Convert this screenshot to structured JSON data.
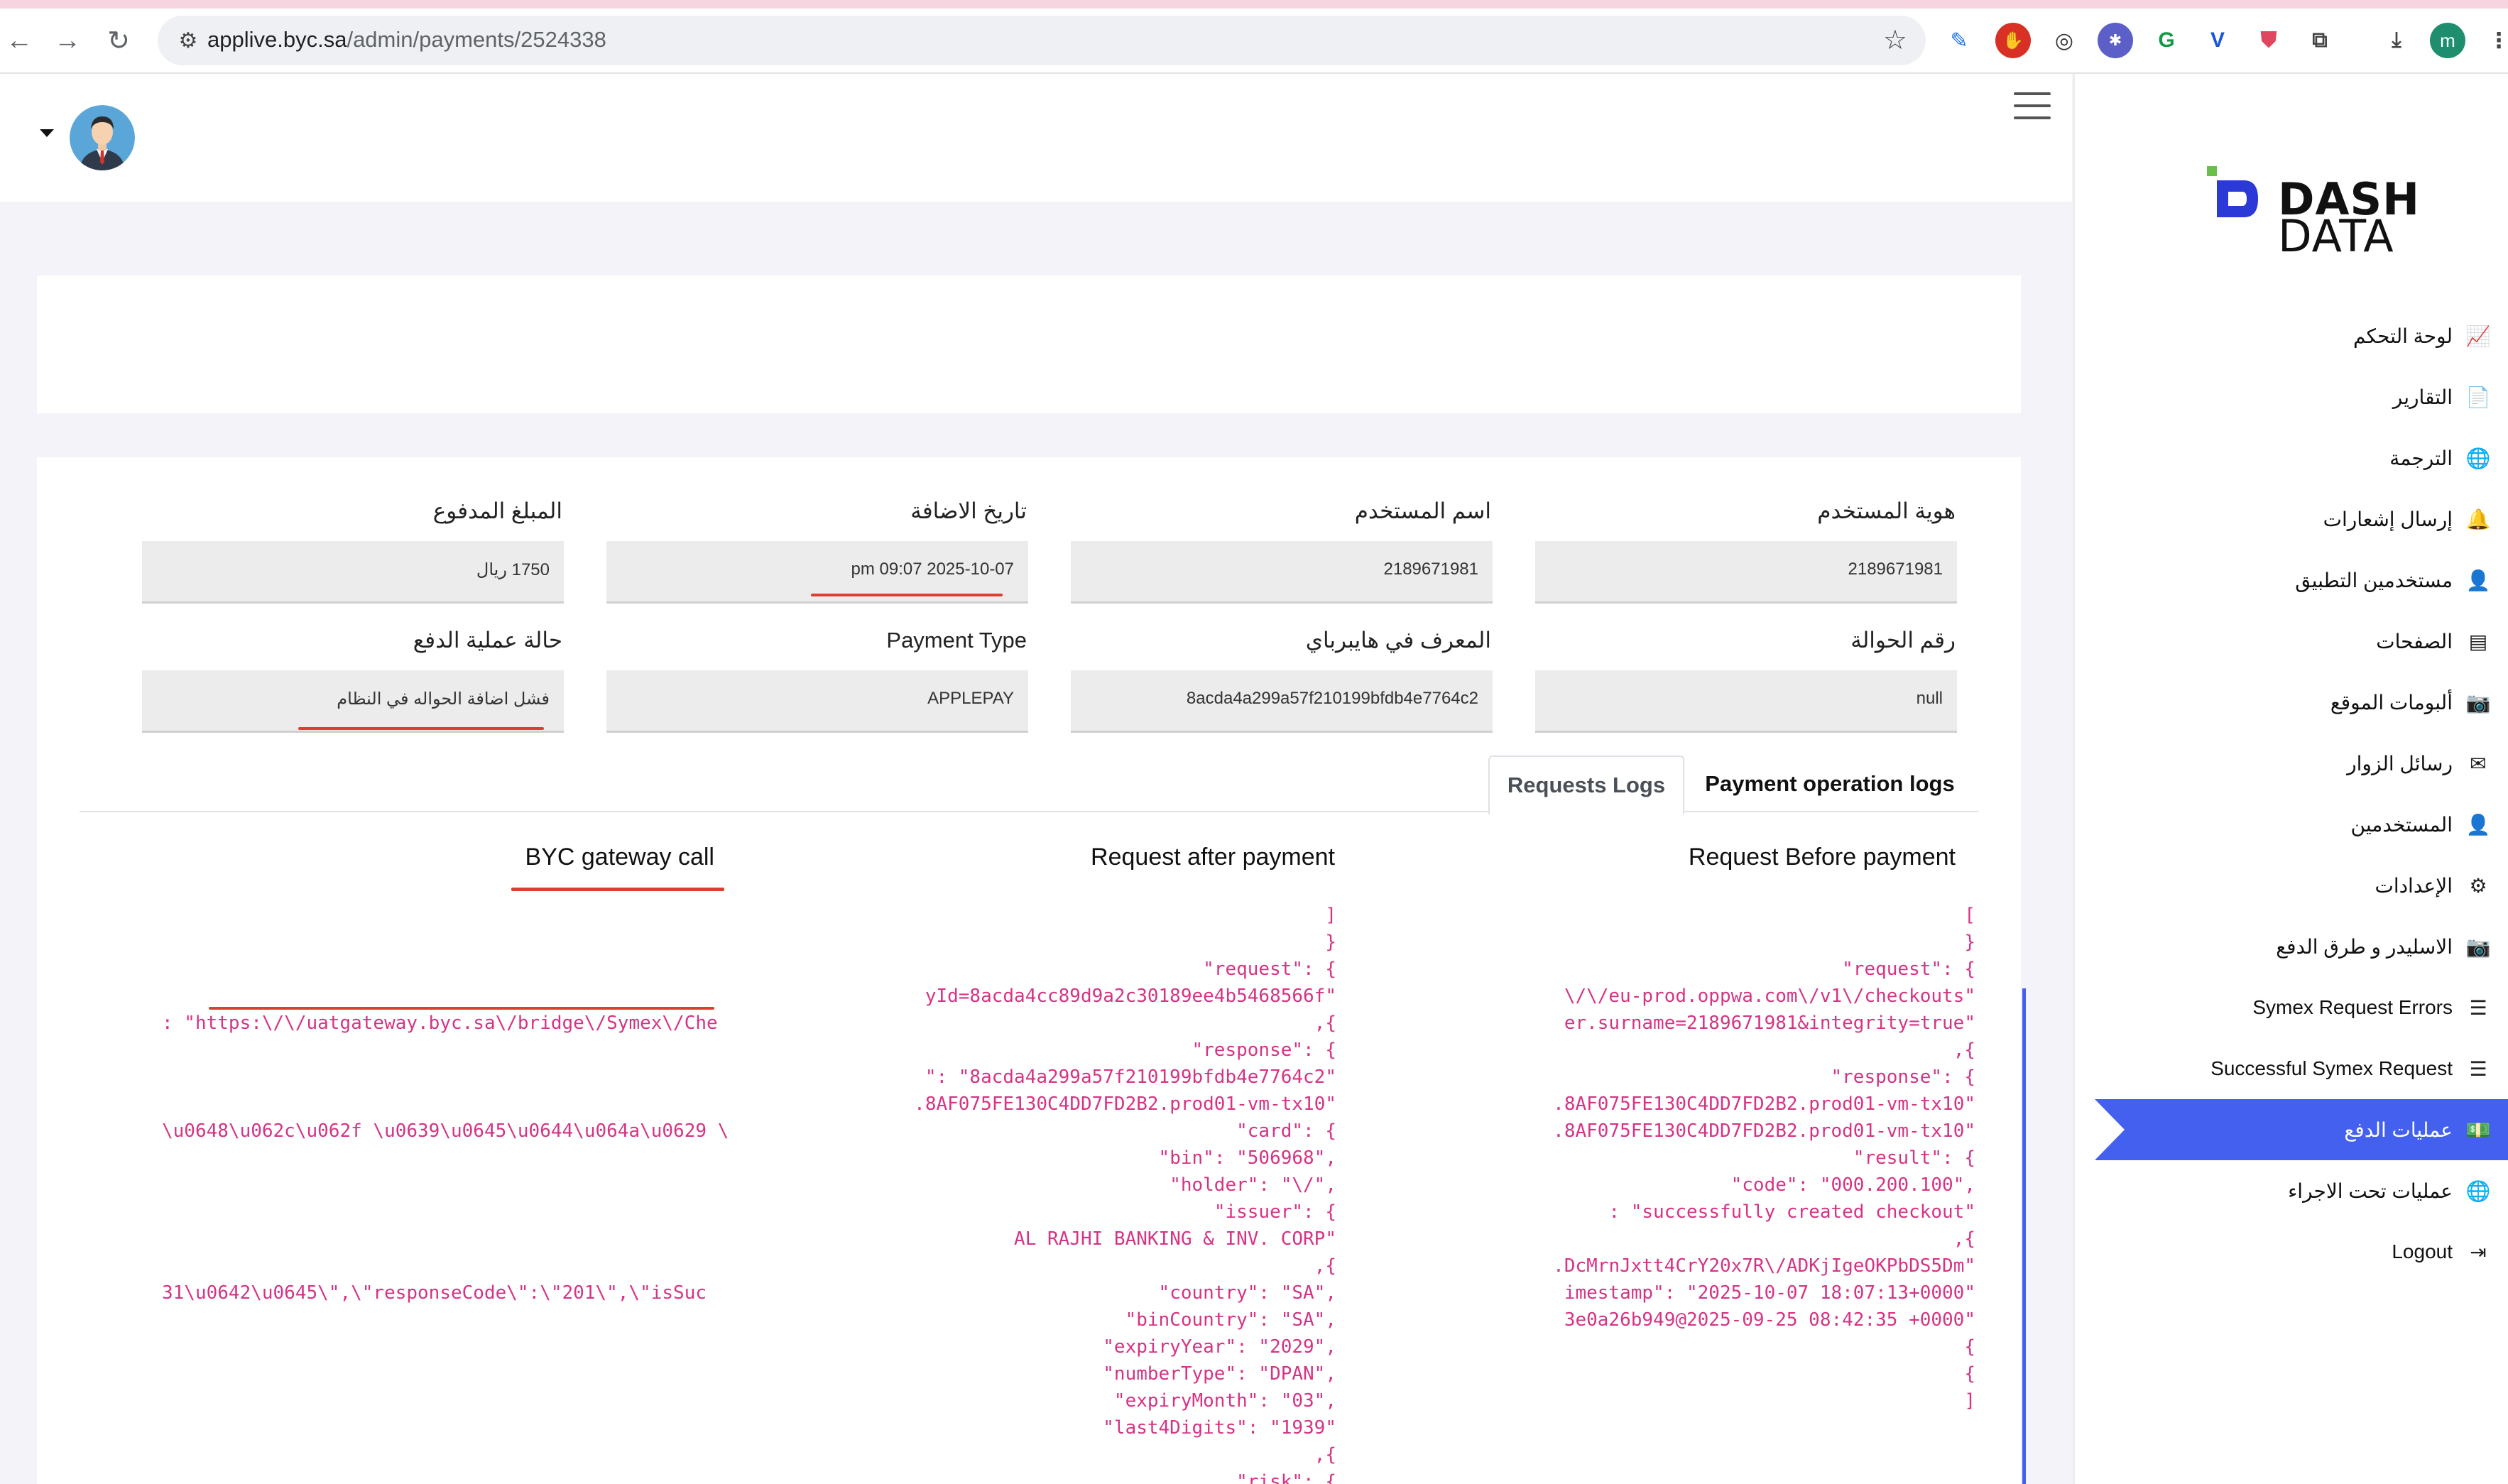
{
  "browser": {
    "url_host": "applive.byc.sa",
    "url_path": "/admin/payments/2524338",
    "profile_initial": "m"
  },
  "sidebar": {
    "logo_line1": "DASH",
    "logo_line2": "DATA",
    "items": [
      {
        "label": "لوحة التحكم",
        "icon": "chart-icon",
        "glyph": "📈"
      },
      {
        "label": "التقارير",
        "icon": "report-icon",
        "glyph": "📄"
      },
      {
        "label": "الترجمة",
        "icon": "globe-icon",
        "glyph": "🌐"
      },
      {
        "label": "إرسال إشعارات",
        "icon": "bell-icon",
        "glyph": "🔔"
      },
      {
        "label": "مستخدمين التطبيق",
        "icon": "user-icon",
        "glyph": "👤"
      },
      {
        "label": "الصفحات",
        "icon": "page-icon",
        "glyph": "▤"
      },
      {
        "label": "ألبومات الموقع",
        "icon": "camera-icon",
        "glyph": "📷"
      },
      {
        "label": "رسائل الزوار",
        "icon": "envelope-icon",
        "glyph": "✉"
      },
      {
        "label": "المستخدمين",
        "icon": "user-icon",
        "glyph": "👤"
      },
      {
        "label": "الإعدادات",
        "icon": "gears-icon",
        "glyph": "⚙"
      },
      {
        "label": "الاسليدر و طرق الدفع",
        "icon": "camera-icon",
        "glyph": "📷"
      },
      {
        "label": "Symex Request Errors",
        "icon": "list-icon",
        "glyph": "☰"
      },
      {
        "label": "Successful Symex Request",
        "icon": "list-icon",
        "glyph": "☰"
      },
      {
        "label": "عمليات الدفع",
        "icon": "money-icon",
        "glyph": "💵"
      },
      {
        "label": "عمليات تحت الاجراء",
        "icon": "globe-icon",
        "glyph": "🌐"
      },
      {
        "label": "Logout",
        "icon": "logout-icon",
        "glyph": "⇥"
      }
    ],
    "active_index": 13
  },
  "fields": {
    "user_id": {
      "label": "هوية المستخدم",
      "value": "2189671981"
    },
    "username": {
      "label": "اسم المستخدم",
      "value": "2189671981"
    },
    "date_added": {
      "label": "تاريخ الاضافة",
      "value": "2025-10-07 09:07 pm"
    },
    "amount_paid": {
      "label": "المبلغ المدفوع",
      "value": "1750 ريال"
    },
    "transfer_no": {
      "label": "رقم الحوالة",
      "value": "null"
    },
    "hyperpay_id": {
      "label": "المعرف في هايبرباي",
      "value": "8acda4a299a57f210199bfdb4e7764c2"
    },
    "payment_type": {
      "label": "Payment Type",
      "value": "APPLEPAY"
    },
    "payment_status": {
      "label": "حالة عملية الدفع",
      "value": "فشل اضافة الحواله في النظام"
    }
  },
  "tabs": {
    "payment_operation_logs": "Payment operation logs",
    "requests_logs": "Requests Logs"
  },
  "columns": {
    "before": {
      "title": "Request Before payment",
      "lines": [
        "[",
        "}",
        "\"request\": {",
        "\\/\\/eu-prod.oppwa.com\\/v1\\/checkouts\"",
        "er.surname=2189671981&integrity=true\"",
        ",{",
        "\"response\": {",
        ".8AF075FE130C4DD7FD2B2.prod01-vm-tx10\"",
        ".8AF075FE130C4DD7FD2B2.prod01-vm-tx10\"",
        "\"result\": {",
        "\"code\": \"000.200.100\",",
        ": \"successfully created checkout\"",
        ",{",
        ".DcMrnJxtt4CrY20x7R\\/ADKjIgeOKPbDS5Dm\"",
        "imestamp\": \"2025-10-07 18:07:13+0000\"",
        "3e0a26b949@2025-09-25 08:42:35 +0000\"",
        "{",
        "{",
        "]"
      ]
    },
    "after": {
      "title": "Request after payment",
      "lines": [
        "]",
        "}",
        "\"request\": {",
        "yId=8acda4cc89d9a2c30189ee4b5468566f\"",
        ",{",
        "\"response\": {",
        "\": \"8acda4a299a57f210199bfdb4e7764c2\"",
        ".8AF075FE130C4DD7FD2B2.prod01-vm-tx10\"",
        "\"card\": {",
        "\"bin\": \"506968\",",
        "\"holder\": \"\\/\",",
        "\"issuer\": {",
        "AL RAJHI BANKING & INV. CORP\"",
        ",{",
        "\"country\": \"SA\",",
        "\"binCountry\": \"SA\",",
        "\"expiryYear\": \"2029\",",
        "\"numberType\": \"DPAN\",",
        "\"expiryMonth\": \"03\",",
        "\"last4Digits\": \"1939\"",
        ",{",
        "\"risk\": {"
      ]
    },
    "gateway": {
      "title": "BYC gateway call",
      "lines": [
        "",
        "",
        ": \"https:\\/\\/uatgateway.byc.sa\\/bridge\\/Symex\\/Che",
        "",
        "",
        "",
        "\\u0648\\u062c\\u062f \\u0639\\u0645\\u0644\\u064a\\u0629 \\",
        "",
        "",
        "",
        "",
        "",
        "31\\u0642\\u0645\\\",\\\"responseCode\\\":\\\"201\\\",\\\"isSuc"
      ]
    }
  },
  "colors": {
    "accent": "#4361ee",
    "code": "#d63384",
    "highlight_underline": "#e03c2f"
  }
}
